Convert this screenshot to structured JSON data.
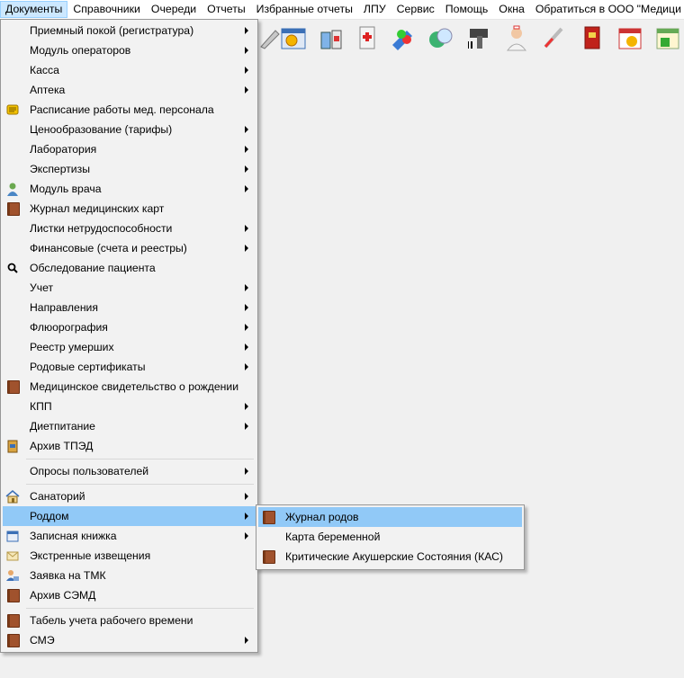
{
  "menubar": {
    "items": [
      "Документы",
      "Справочники",
      "Очереди",
      "Отчеты",
      "Избранные отчеты",
      "ЛПУ",
      "Сервис",
      "Помощь",
      "Окна",
      "Обратиться в ООО \"Медици"
    ]
  },
  "toolbar": {
    "icons": [
      "pen-icon",
      "calendar-clock-icon",
      "medicine-bottles-icon",
      "first-aid-icon",
      "syringe-icon",
      "pills-icon",
      "barcode-scanner-icon",
      "nurse-icon",
      "thermometer-icon",
      "red-book-icon",
      "calendar-alarm-icon",
      "calendar-lock-icon"
    ]
  },
  "menu": {
    "items": [
      {
        "label": "Приемный покой (регистратура)",
        "icon": "",
        "submenu": true
      },
      {
        "label": "Модуль операторов",
        "icon": "",
        "submenu": true
      },
      {
        "label": "Касса",
        "icon": "",
        "submenu": true
      },
      {
        "label": "Аптека",
        "icon": "",
        "submenu": true
      },
      {
        "label": "Расписание работы мед. персонала",
        "icon": "schedule-icon",
        "submenu": false
      },
      {
        "label": "Ценообразование (тарифы)",
        "icon": "",
        "submenu": true
      },
      {
        "label": "Лаборатория",
        "icon": "",
        "submenu": true
      },
      {
        "label": "Экспертизы",
        "icon": "",
        "submenu": true
      },
      {
        "label": "Модуль врача",
        "icon": "doctor-icon",
        "submenu": true
      },
      {
        "label": "Журнал медицинских карт",
        "icon": "book-icon",
        "submenu": false
      },
      {
        "label": "Листки нетрудоспособности",
        "icon": "",
        "submenu": true
      },
      {
        "label": "Финансовые (счета и реестры)",
        "icon": "",
        "submenu": true
      },
      {
        "label": "Обследование пациента",
        "icon": "magnifier-icon",
        "submenu": false
      },
      {
        "label": "Учет",
        "icon": "",
        "submenu": true
      },
      {
        "label": "Направления",
        "icon": "",
        "submenu": true
      },
      {
        "label": "Флюорография",
        "icon": "",
        "submenu": true
      },
      {
        "label": "Реестр умерших",
        "icon": "",
        "submenu": true
      },
      {
        "label": "Родовые сертификаты",
        "icon": "",
        "submenu": true
      },
      {
        "label": "Медицинское свидетельство о рождении",
        "icon": "book-icon",
        "submenu": false
      },
      {
        "label": "КПП",
        "icon": "",
        "submenu": true
      },
      {
        "label": "Диетпитание",
        "icon": "",
        "submenu": true
      },
      {
        "label": "Архив ТПЭД",
        "icon": "archive-icon",
        "submenu": false
      },
      {
        "label": "Опросы пользователей",
        "icon": "",
        "submenu": true
      },
      {
        "label": "Санаторий",
        "icon": "house-icon",
        "submenu": true
      },
      {
        "label": "Роддом",
        "icon": "",
        "submenu": true
      },
      {
        "label": "Записная книжка",
        "icon": "notebook-icon",
        "submenu": true
      },
      {
        "label": "Экстренные извещения",
        "icon": "envelope-icon",
        "submenu": false
      },
      {
        "label": "Заявка на ТМК",
        "icon": "user-computer-icon",
        "submenu": false
      },
      {
        "label": "Архив СЭМД",
        "icon": "book-icon",
        "submenu": false
      },
      {
        "label": "Табель учета рабочего времени",
        "icon": "book-icon",
        "submenu": false
      },
      {
        "label": "СМЭ",
        "icon": "book-icon",
        "submenu": true
      }
    ]
  },
  "submenu": {
    "items": [
      {
        "label": "Журнал родов",
        "icon": "book-icon"
      },
      {
        "label": "Карта беременной",
        "icon": ""
      },
      {
        "label": "Критические Акушерские Состояния (КАС)",
        "icon": "book-icon"
      }
    ]
  },
  "colors": {
    "highlight": "#91c9f7",
    "menubar_active": "#cce8ff",
    "book": "#a0522d"
  }
}
